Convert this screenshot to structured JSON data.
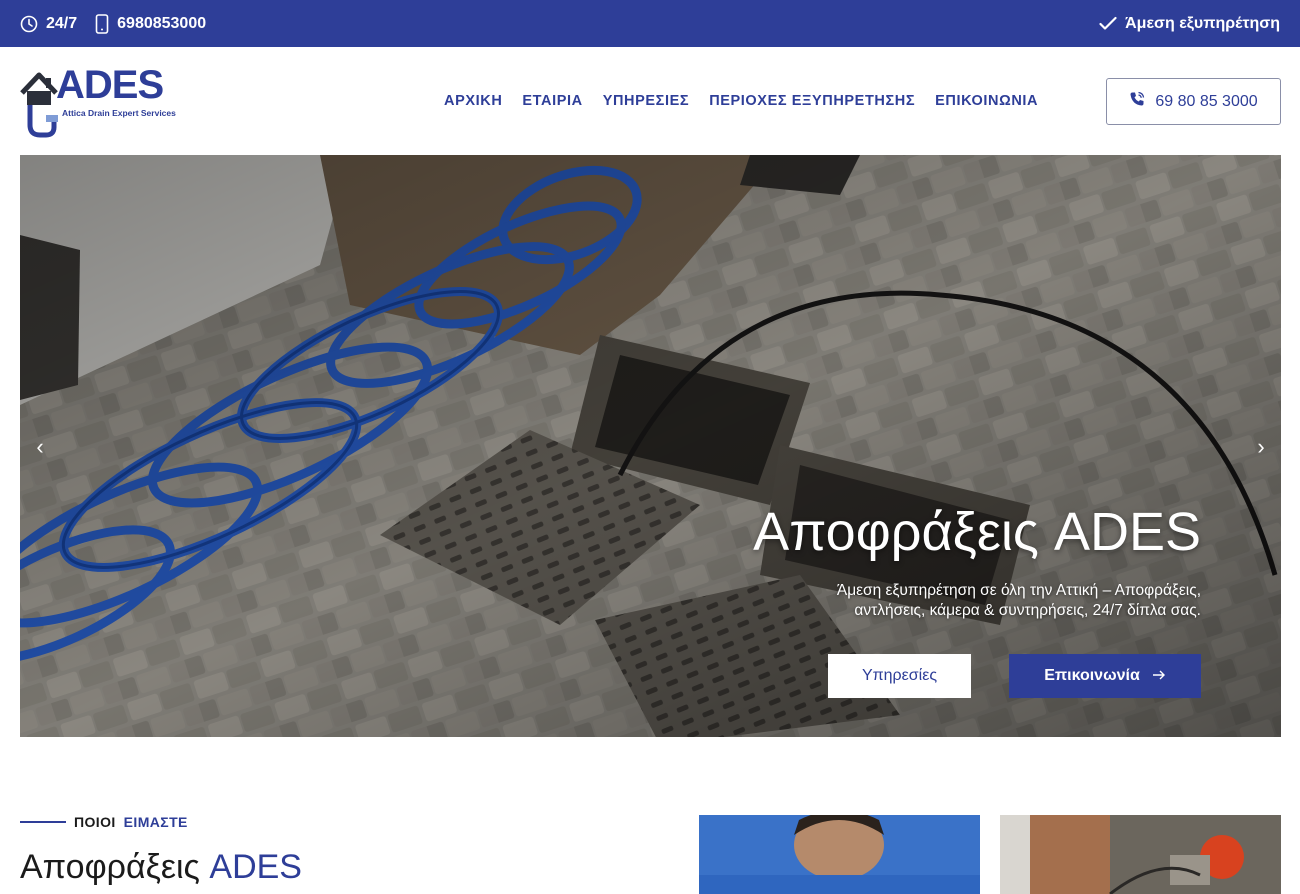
{
  "topbar": {
    "hours": "24/7",
    "phone": "6980853000",
    "service_note": "Άμεση εξυπηρέτηση"
  },
  "header": {
    "logo": {
      "word": "ADES",
      "tagline": "Attica Drain Expert Services"
    },
    "nav": [
      "ΑΡΧΙΚΗ",
      "ΕΤΑΙΡΙΑ",
      "ΥΠΗΡΕΣΙΕΣ",
      "ΠΕΡΙΟΧΕΣ ΕΞΥΠΗΡΕΤΗΣΗΣ",
      "ΕΠΙΚΟΙΝΩΝΙΑ"
    ],
    "phone_button": "69 80 85 3000"
  },
  "hero": {
    "title": "Αποφράξεις ADES",
    "subtitle": "Άμεση εξυπηρέτηση σε όλη την Αττική – Αποφράξεις, αντλήσεις, κάμερα & συντηρήσεις, 24/7 δίπλα σας.",
    "button_services": "Υπηρεσίες",
    "button_contact": "Επικοινωνία",
    "prev_arrow": "‹",
    "next_arrow": "›"
  },
  "about": {
    "eyebrow_part1": "ΠΟΙΟΙ",
    "eyebrow_part2": "ΕΙΜΑΣΤΕ",
    "title_part1": "Αποφράξεις",
    "title_part2": "ADES"
  },
  "colors": {
    "brand": "#2e3e98",
    "hose": "#1f4fa8",
    "paving": "#8b877f"
  },
  "icons": [
    "clock-icon",
    "smartphone-icon",
    "check-icon",
    "phone-icon",
    "arrow-right-icon",
    "chevron-left-icon",
    "chevron-right-icon",
    "house-icon",
    "pipe-icon"
  ]
}
